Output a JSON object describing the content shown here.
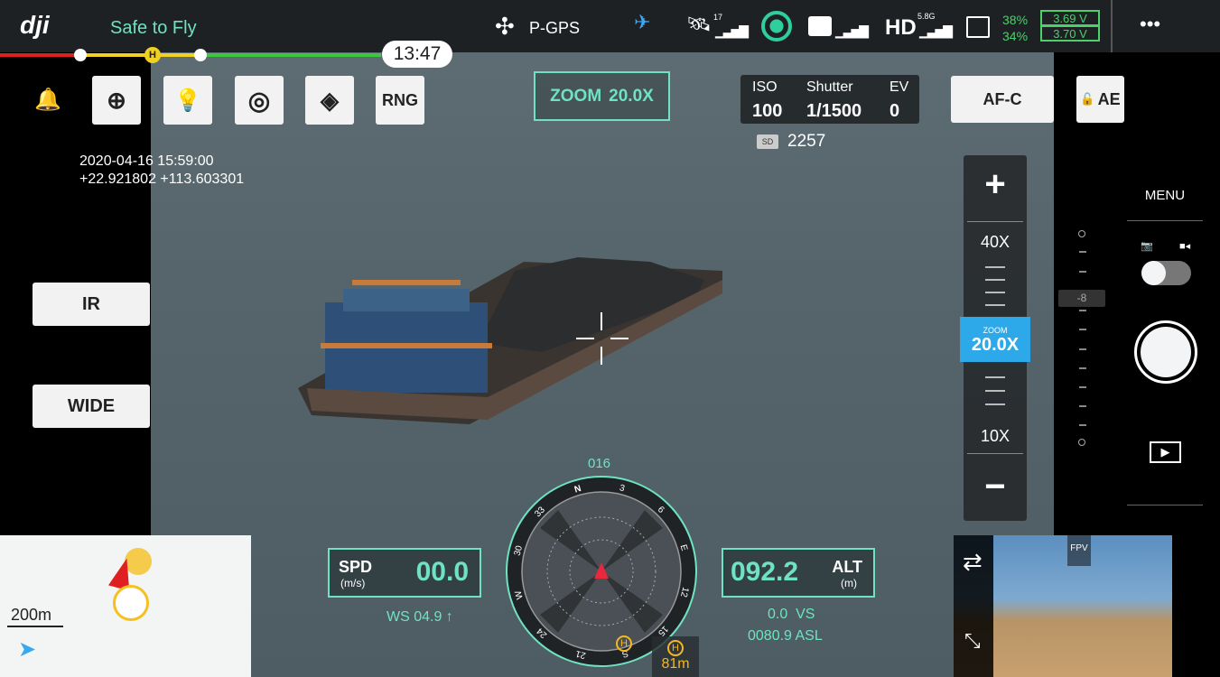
{
  "top_bar": {
    "logo": "dji",
    "status": "Safe to Fly",
    "flight_time": "13:47",
    "flight_mode": "P-GPS",
    "gps_sats": "17",
    "hd_band": "5.8G",
    "hd_label": "HD",
    "battery_pct_1": "38%",
    "battery_pct_2": "34%",
    "battery_v_1": "3.69 V",
    "battery_v_2": "3.70 V",
    "more": "•••",
    "status_color": "#6fe3c1"
  },
  "toolbar": {
    "rng_label": "RNG",
    "zoom_label": "ZOOM",
    "zoom_value": "20.0X",
    "af_mode": "AF-C",
    "ae_lock": "AE"
  },
  "exposure": {
    "iso_label": "ISO",
    "iso": "100",
    "shutter_label": "Shutter",
    "shutter": "1/1500",
    "ev_label": "EV",
    "ev": "0",
    "sd_label": "SD",
    "sd_remaining": "2257"
  },
  "overlay": {
    "datetime": "2020-04-16 15:59:00",
    "coords": "+22.921802 +113.603301"
  },
  "left_buttons": {
    "ir": "IR",
    "wide": "WIDE"
  },
  "zoom_slider": {
    "max_label": "40X",
    "min_label": "10X",
    "current_label": "ZOOM",
    "current": "20.0X",
    "plus": "+",
    "minus": "−"
  },
  "right_panel": {
    "menu": "MENU",
    "ev_slider_value": "-8",
    "mode": "photo"
  },
  "telemetry": {
    "spd_label": "SPD",
    "spd_unit": "(m/s)",
    "spd": "00.0",
    "ws": "WS 04.9 ↑",
    "alt_label": "ALT",
    "alt_unit": "(m)",
    "alt": "092.2",
    "vs": "0.0  VS",
    "asl": "0080.9 ASL",
    "heading": "016",
    "home_distance": "81m"
  },
  "compass": {
    "labels": [
      "N",
      "3",
      "6",
      "E",
      "12",
      "15",
      "S",
      "21",
      "24",
      "W",
      "30",
      "33"
    ]
  },
  "map": {
    "scale": "200m"
  },
  "fpv": {
    "label": "FPV"
  }
}
